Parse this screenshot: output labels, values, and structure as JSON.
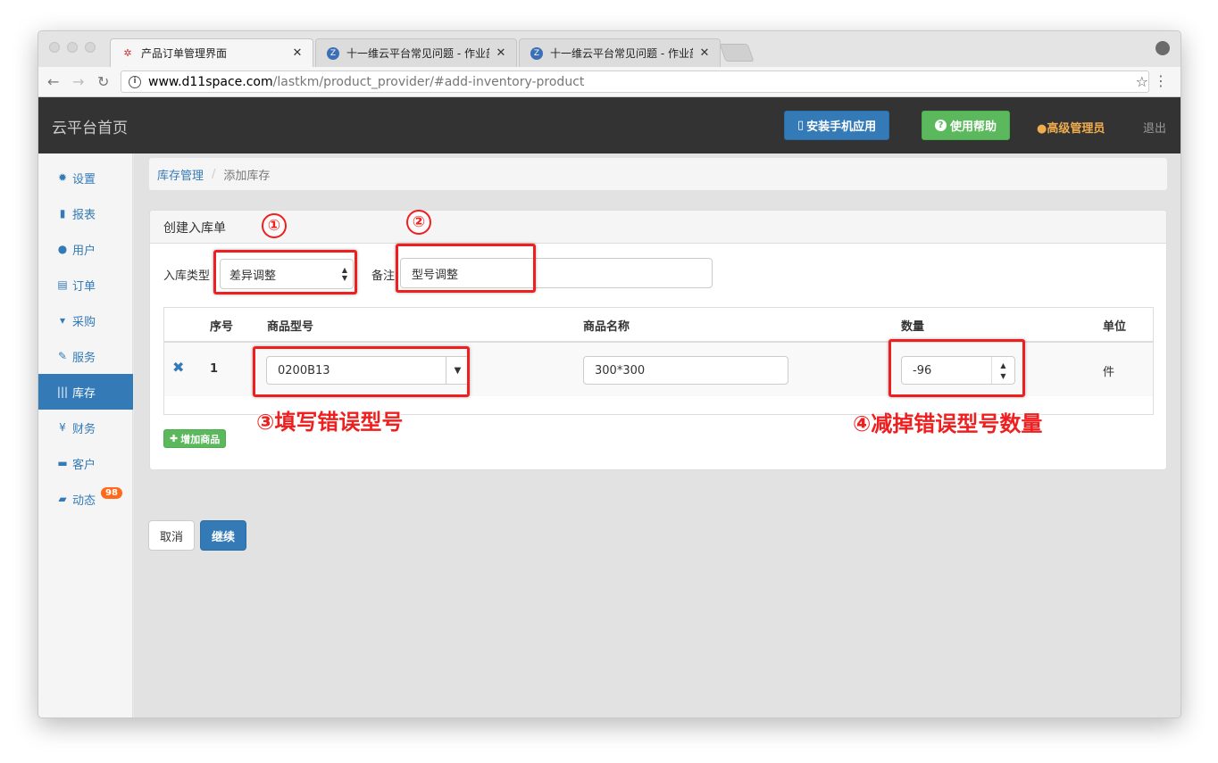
{
  "browser": {
    "tabs": [
      {
        "title": "产品订单管理界面",
        "icon": "app-logo-icon"
      },
      {
        "title": "十一维云平台常见问题 - 作业部落",
        "icon": "zybuluo-icon"
      },
      {
        "title": "十一维云平台常见问题 - 作业部落",
        "icon": "zybuluo-icon"
      }
    ],
    "url_host": "www.d11space.com",
    "url_path": "/lastkm/product_provider/#add-inventory-product"
  },
  "navbar": {
    "brand": "云平台首页",
    "install_app": "安装手机应用",
    "help": "使用帮助",
    "user": "高级管理员",
    "logout": "退出"
  },
  "sidebar": {
    "items": [
      {
        "label": "设置",
        "icon": "gear-icon"
      },
      {
        "label": "报表",
        "icon": "bar-chart-icon"
      },
      {
        "label": "用户",
        "icon": "user-icon"
      },
      {
        "label": "订单",
        "icon": "list-icon"
      },
      {
        "label": "采购",
        "icon": "cart-icon"
      },
      {
        "label": "服务",
        "icon": "wrench-icon"
      },
      {
        "label": "库存",
        "icon": "barcode-icon",
        "active": true
      },
      {
        "label": "财务",
        "icon": "yen-icon"
      },
      {
        "label": "客户",
        "icon": "briefcase-icon"
      },
      {
        "label": "动态",
        "icon": "comment-icon",
        "badge": "98"
      }
    ]
  },
  "breadcrumb": {
    "parent": "库存管理",
    "current": "添加库存"
  },
  "panel": {
    "title": "创建入库单",
    "type_label": "入库类型",
    "type_value": "差异调整",
    "note_label": "备注",
    "note_value": "型号调整"
  },
  "table": {
    "headers": {
      "index": "序号",
      "model": "商品型号",
      "name": "商品名称",
      "qty": "数量",
      "unit": "单位"
    },
    "rows": [
      {
        "index": "1",
        "model": "0200B13",
        "name": "300*300",
        "qty": "-96",
        "unit": "件"
      }
    ],
    "add_button": "增加商品"
  },
  "actions": {
    "cancel": "取消",
    "continue": "继续"
  },
  "annotations": {
    "n1": "①",
    "n2": "②",
    "n3": "③填写错误型号",
    "n4": "④减掉错误型号数量"
  },
  "colors": {
    "primary": "#337ab7",
    "success": "#5cb85c",
    "annotation": "#f01f1f",
    "navbar": "#333333",
    "warning": "#f0ad4e"
  }
}
